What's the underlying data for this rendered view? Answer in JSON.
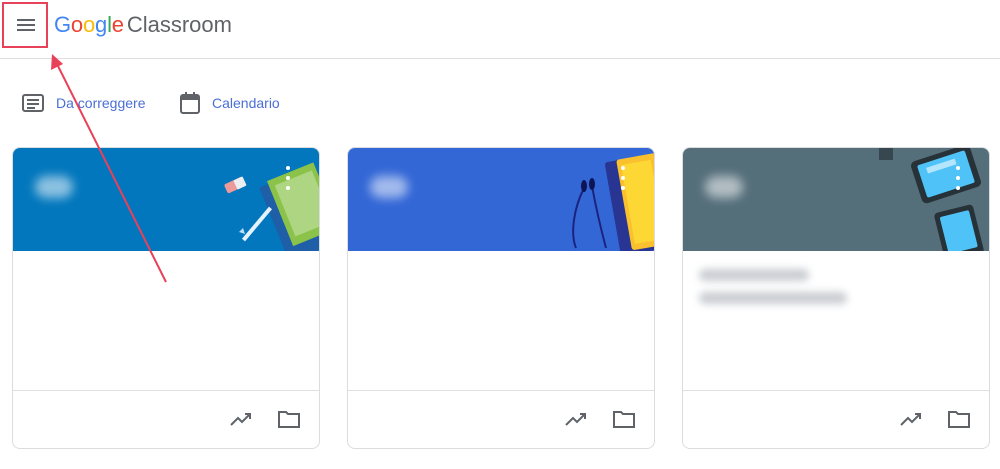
{
  "header": {
    "logo": {
      "letters": [
        {
          "ch": "G",
          "color": "#4285F4"
        },
        {
          "ch": "o",
          "color": "#EA4335"
        },
        {
          "ch": "o",
          "color": "#FBBC05"
        },
        {
          "ch": "g",
          "color": "#4285F4"
        },
        {
          "ch": "l",
          "color": "#34A853"
        },
        {
          "ch": "e",
          "color": "#EA4335"
        }
      ],
      "product": "Classroom"
    },
    "menu_icon": "hamburger-menu-icon"
  },
  "shortcuts": {
    "to_review": {
      "label": "Da correggere",
      "icon": "assignment-list-icon"
    },
    "calendar": {
      "label": "Calendario",
      "icon": "calendar-icon"
    }
  },
  "cards": [
    {
      "theme_color": "#0277BD",
      "art": "pencil-notebook",
      "footer_icons": [
        "trending-up-icon",
        "folder-icon"
      ]
    },
    {
      "theme_color": "#3367D6",
      "art": "headphones-book",
      "footer_icons": [
        "trending-up-icon",
        "folder-icon"
      ]
    },
    {
      "theme_color": "#546E7A",
      "art": "tablet-devices",
      "footer_icons": [
        "trending-up-icon",
        "folder-icon"
      ]
    }
  ],
  "colors": {
    "link": "#4a6fd6",
    "annotation": "#e8415a",
    "divider": "#e0e0e0"
  }
}
